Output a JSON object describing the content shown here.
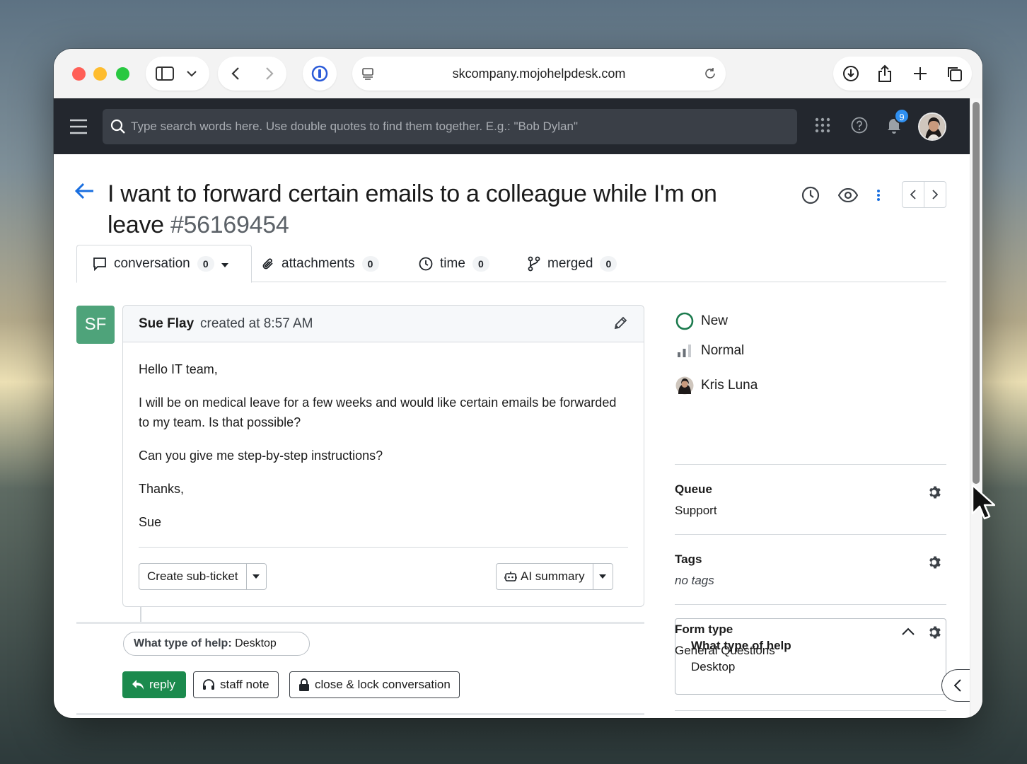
{
  "browser": {
    "url": "skcompany.mojohelpdesk.com"
  },
  "header": {
    "search_placeholder": "Type search words here. Use double quotes to find them together. E.g.: \"Bob Dylan\"",
    "notification_count": "9"
  },
  "ticket": {
    "title": "I want to forward certain emails to a colleague while I'm on leave",
    "number": "#56169454"
  },
  "tabs": [
    {
      "label": "conversation",
      "count": "0"
    },
    {
      "label": "attachments",
      "count": "0"
    },
    {
      "label": "time",
      "count": "0"
    },
    {
      "label": "merged",
      "count": "0"
    }
  ],
  "message": {
    "initials": "SF",
    "author": "Sue Flay",
    "meta": "created at 8:57 AM",
    "body": [
      "Hello IT team,",
      "I will be on medical leave for a few weeks and would like certain emails be forwarded to my team. Is that possible?",
      "Can you give me step-by-step instructions?",
      "Thanks,",
      "Sue"
    ],
    "sub_ticket_label": "Create sub-ticket",
    "ai_summary_label": "AI summary"
  },
  "field_chip": {
    "label": "What type of help:",
    "value": "Desktop"
  },
  "actions": {
    "reply": "reply",
    "staff_note": "staff note",
    "close_lock": "close & lock conversation"
  },
  "sidebar": {
    "status": "New",
    "priority": "Normal",
    "assignee": "Kris Luna",
    "queue_label": "Queue",
    "queue_value": "Support",
    "tags_label": "Tags",
    "tags_value": "no tags",
    "form_type_label": "Form type",
    "form_type_value": "General Questions",
    "form_field_label": "What type of help",
    "form_field_value": "Desktop"
  },
  "colors": {
    "accent_blue": "#1a6fe0",
    "reply_green": "#1b8a4d",
    "status_green": "#1b7a4d",
    "avatar_green": "#4ea37a",
    "header_dark": "#23272e"
  }
}
